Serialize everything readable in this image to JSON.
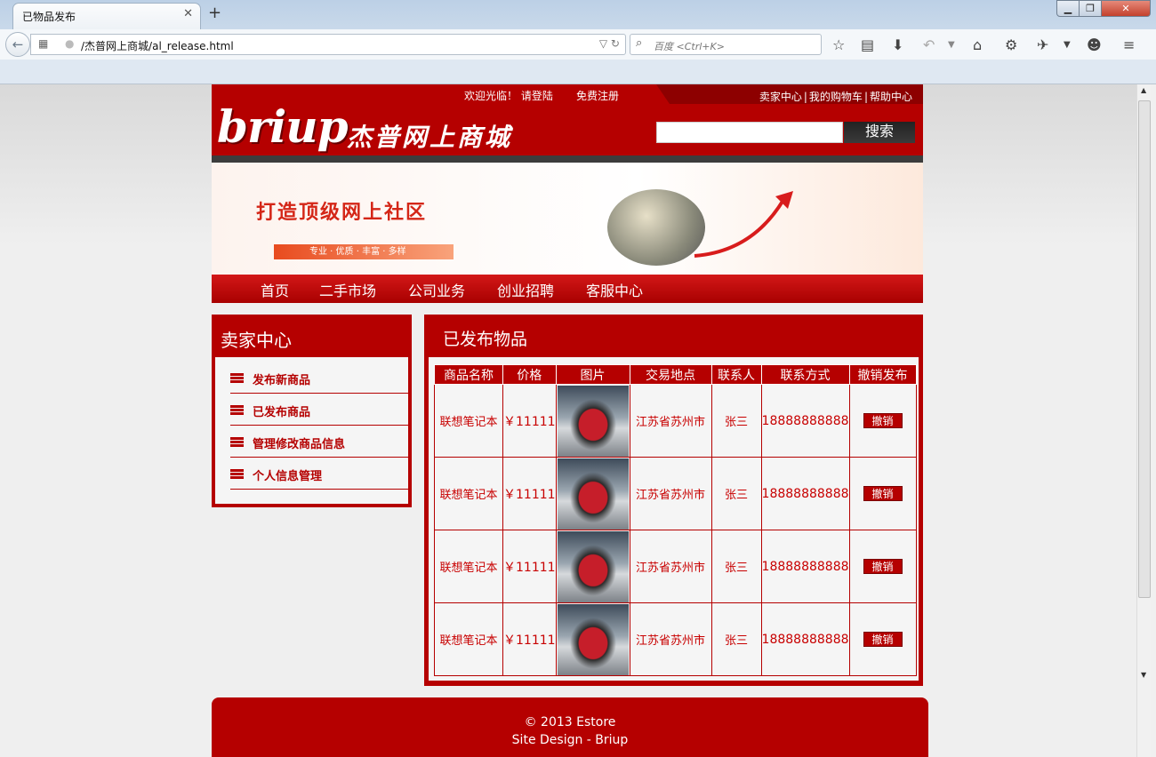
{
  "browser": {
    "tab_title": "已物品发布",
    "url": "/杰普网上商城/al_release.html",
    "search_placeholder": "百度 <Ctrl+K>"
  },
  "site": {
    "welcome": "欢迎光临！ 请登陆",
    "register": "免费注册",
    "top_links": [
      "卖家中心",
      "我的购物车",
      "帮助中心"
    ],
    "logo": "briup",
    "shop_name": "杰普网上商城",
    "search_button": "搜索"
  },
  "banner": {
    "title": "打造顶级网上社区",
    "subtitle": "专业 · 优质 · 丰富 · 多样"
  },
  "menu": [
    "首页",
    "二手市场",
    "公司业务",
    "创业招聘",
    "客服中心"
  ],
  "seller_center": {
    "title": "卖家中心",
    "items": [
      "发布新商品",
      "已发布商品",
      "管理修改商品信息",
      "个人信息管理"
    ]
  },
  "released": {
    "title": "已发布物品",
    "columns": [
      "商品名称",
      "价格",
      "图片",
      "交易地点",
      "联系人",
      "联系方式",
      "撤销发布"
    ],
    "rows": [
      {
        "name": "联想笔记本",
        "price": "￥11111",
        "location": "江苏省苏州市",
        "contact": "张三",
        "phone": "18888888888",
        "action": "撤销"
      },
      {
        "name": "联想笔记本",
        "price": "￥11111",
        "location": "江苏省苏州市",
        "contact": "张三",
        "phone": "18888888888",
        "action": "撤销"
      },
      {
        "name": "联想笔记本",
        "price": "￥11111",
        "location": "江苏省苏州市",
        "contact": "张三",
        "phone": "18888888888",
        "action": "撤销"
      },
      {
        "name": "联想笔记本",
        "price": "￥11111",
        "location": "江苏省苏州市",
        "contact": "张三",
        "phone": "18888888888",
        "action": "撤销"
      }
    ]
  },
  "footer": {
    "line1": "© 2013 Estore",
    "line2": "Site Design - Briup"
  },
  "colors": {
    "brand_red": "#b50000",
    "dark_red": "#8d0000"
  }
}
